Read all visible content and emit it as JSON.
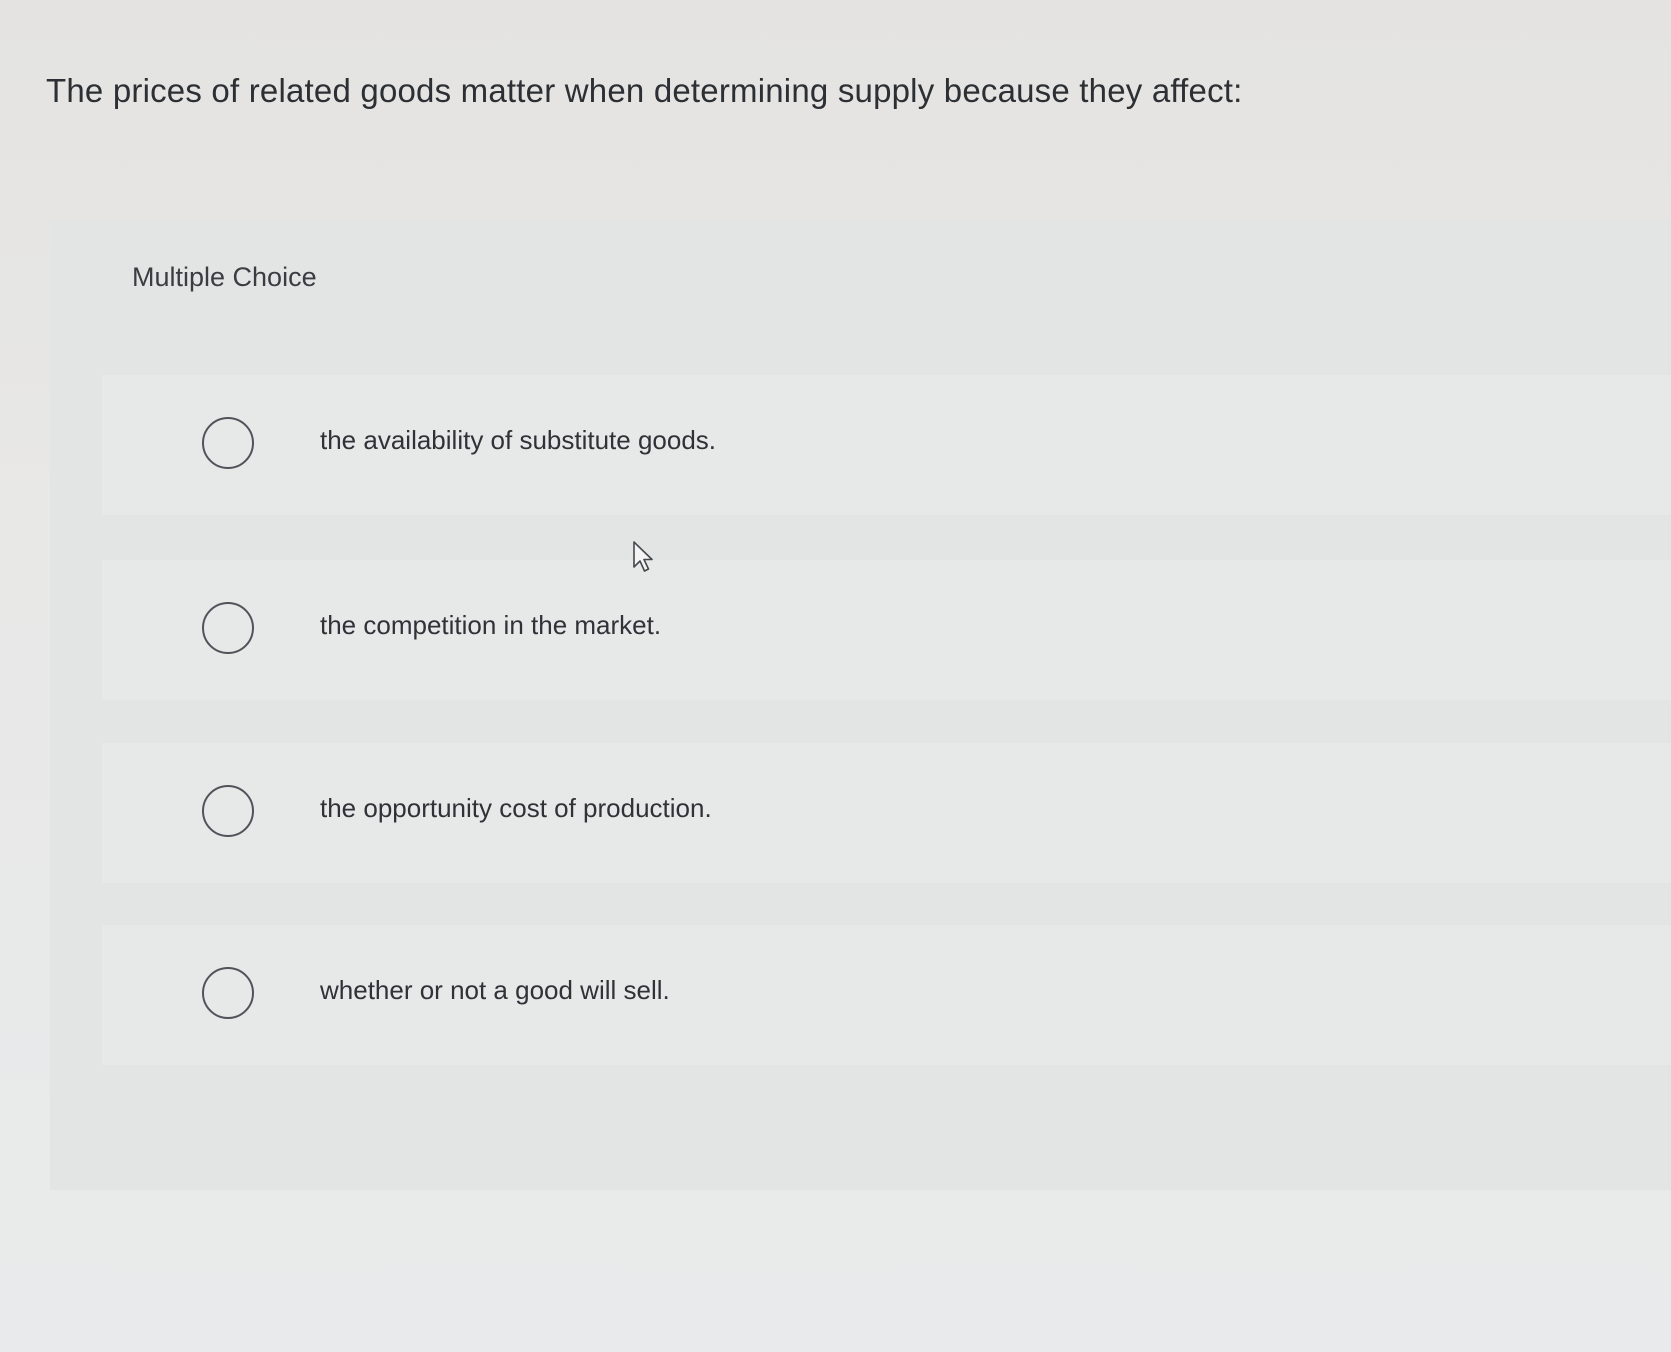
{
  "question": {
    "text": "The prices of related goods matter when determining supply because they affect:"
  },
  "multiple_choice": {
    "label": "Multiple Choice",
    "options": [
      {
        "text": "the availability of substitute goods."
      },
      {
        "text": "the competition in the market."
      },
      {
        "text": "the opportunity cost of production."
      },
      {
        "text": "whether or not a good will sell."
      }
    ]
  }
}
